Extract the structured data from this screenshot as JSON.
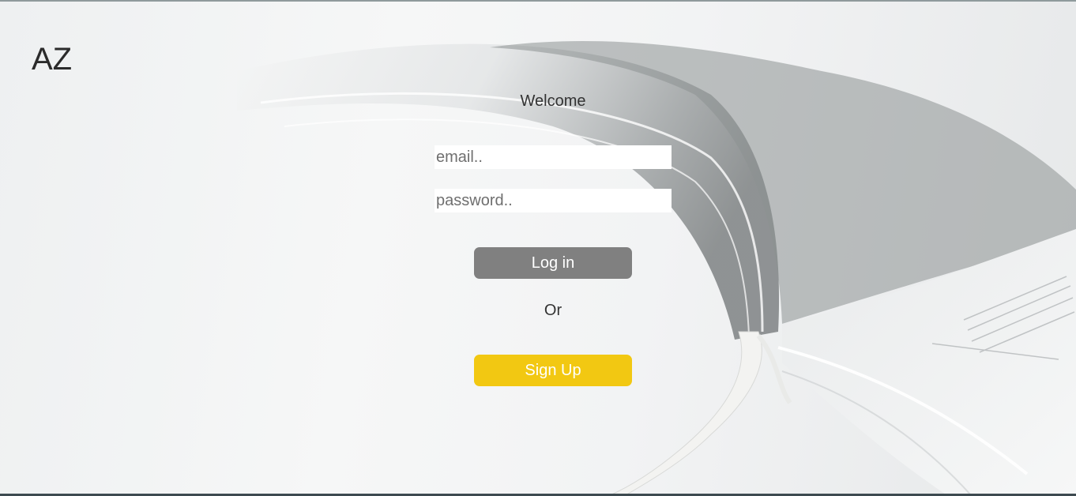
{
  "brand": {
    "text": "AZ"
  },
  "form": {
    "heading": "Welcome",
    "email_placeholder": "email..",
    "password_placeholder": "password..",
    "login_label": "Log in",
    "separator": "Or",
    "signup_label": "Sign Up"
  },
  "colors": {
    "login_button": "#808080",
    "signup_button": "#f2c812",
    "text": "#333333"
  }
}
